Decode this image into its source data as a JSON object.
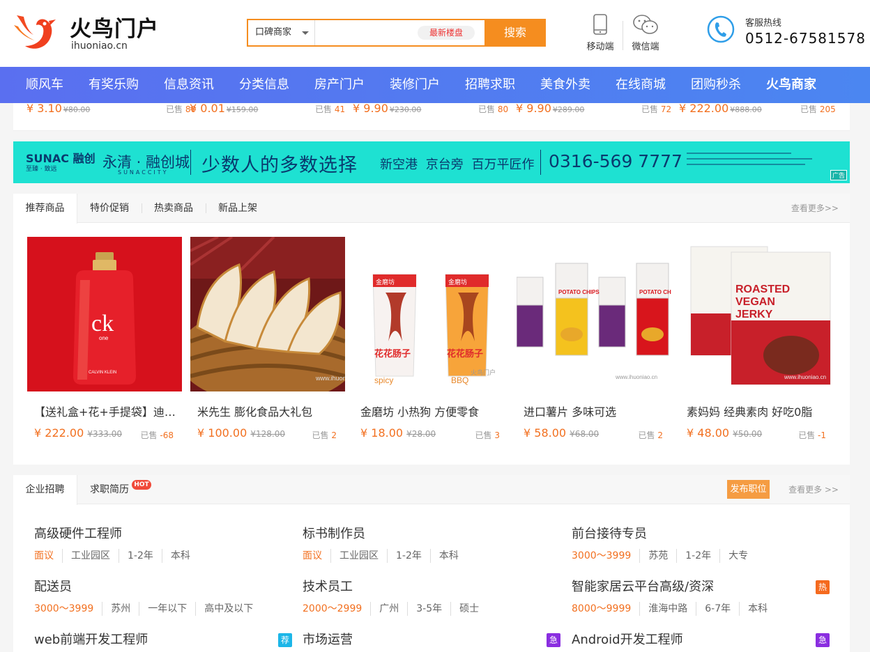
{
  "header": {
    "logo_text": "火鸟门户",
    "logo_domain": "ihuoniao.cn",
    "search_type": "口碑商家",
    "search_placeholder": "",
    "search_tag": "最新楼盘",
    "search_button": "搜索",
    "mobile_label": "移动端",
    "wechat_label": "微信端",
    "hotline_label": "客服热线",
    "hotline_number": "0512-67581578"
  },
  "nav": [
    "顺风车",
    "有奖乐购",
    "信息资讯",
    "分类信息",
    "房产门户",
    "装修门户",
    "招聘求职",
    "美食外卖",
    "在线商城",
    "团购秒杀",
    "火鸟商家"
  ],
  "strip": [
    {
      "price": "¥ 3.10",
      "old": "¥80.00",
      "sold_label": "已售",
      "sold": "80"
    },
    {
      "price": "¥ 0.01",
      "old": "¥159.00",
      "sold_label": "已售",
      "sold": "41"
    },
    {
      "price": "¥ 9.90",
      "old": "¥230.00",
      "sold_label": "已售",
      "sold": "80"
    },
    {
      "price": "¥ 9.90",
      "old": "¥289.00",
      "sold_label": "已售",
      "sold": "72"
    },
    {
      "price": "¥ 222.00",
      "old": "¥888.00",
      "sold_label": "已售",
      "sold": "205"
    }
  ],
  "banner": {
    "brand": "SUNAC 融创",
    "brand_sub": "至臻 · 致远",
    "title": "永清 · 融创城",
    "title_sub": "SUNACCITY",
    "slogan": "少数人的多数选择",
    "tags": "新空港 京台旁 百万平匠作",
    "phone": "0316-569 7777",
    "ad_label": "广告"
  },
  "goods": {
    "tabs": [
      "推荐商品",
      "特价促销",
      "热卖商品",
      "新品上架"
    ],
    "more": "查看更多>>",
    "items": [
      {
        "name": "【送礼盒+花+手提袋】迪奥香水",
        "price": "¥ 222.00",
        "old": "¥333.00",
        "sold_label": "已售",
        "sold": "-68",
        "image": "perfume-image"
      },
      {
        "name": "米先生 膨化食品大礼包",
        "price": "¥ 100.00",
        "old": "¥128.00",
        "sold_label": "已售",
        "sold": "2",
        "image": "bread-image"
      },
      {
        "name": "金磨坊 小热狗 方便零食",
        "price": "¥ 18.00",
        "old": "¥28.00",
        "sold_label": "已售",
        "sold": "3",
        "image": "sausage-image"
      },
      {
        "name": "进口薯片 多味可选",
        "price": "¥ 58.00",
        "old": "¥68.00",
        "sold_label": "已售",
        "sold": "2",
        "image": "chips-image"
      },
      {
        "name": "素妈妈 经典素肉 好吃0脂",
        "price": "¥ 48.00",
        "old": "¥50.00",
        "sold_label": "已售",
        "sold": "-1",
        "image": "jerky-image"
      }
    ],
    "image_text": {
      "perfume_brand": "ck",
      "perfume_sub": "one",
      "perfume_small": "CALVIN KLEIN",
      "sausage_brand": "金磨坊",
      "sausage_label": "花花肠子",
      "sausage_flavor1": "spicy",
      "sausage_flavor2": "BBQ",
      "chips_label": "POTATO CHIPS",
      "jerky_label1": "ROASTED",
      "jerky_label2": "VEGAN",
      "jerky_label3": "JERKY",
      "watermark": "火鸟门户",
      "watermark_domain": "www.ihuoniao.cn"
    }
  },
  "jobs": {
    "tabs": [
      "企业招聘",
      "求职简历"
    ],
    "hot_badge": "HOT",
    "publish": "发布职位",
    "more": "查看更多 >>",
    "items": [
      {
        "title": "高级硬件工程师",
        "salary": "面议",
        "area": "工业园区",
        "exp": "1-2年",
        "edu": "本科",
        "tag": "",
        "tag_color": ""
      },
      {
        "title": "标书制作员",
        "salary": "面议",
        "area": "工业园区",
        "exp": "1-2年",
        "edu": "本科",
        "tag": "",
        "tag_color": ""
      },
      {
        "title": "前台接待专员",
        "salary": "3000～3999",
        "area": "苏苑",
        "exp": "1-2年",
        "edu": "大专",
        "tag": "",
        "tag_color": ""
      },
      {
        "title": "配送员",
        "salary": "3000～3999",
        "area": "苏州",
        "exp": "一年以下",
        "edu": "高中及以下",
        "tag": "",
        "tag_color": ""
      },
      {
        "title": "技术员工",
        "salary": "2000～2999",
        "area": "广州",
        "exp": "3-5年",
        "edu": "硕士",
        "tag": "",
        "tag_color": ""
      },
      {
        "title": "智能家居云平台高级/资深",
        "salary": "8000～9999",
        "area": "淮海中路",
        "exp": "6-7年",
        "edu": "本科",
        "tag": "热",
        "tag_color": "#f56a1e"
      },
      {
        "title": "web前端开发工程师",
        "salary": "",
        "area": "",
        "exp": "",
        "edu": "",
        "tag": "荐",
        "tag_color": "#1cb6e8"
      },
      {
        "title": "市场运营",
        "salary": "",
        "area": "",
        "exp": "",
        "edu": "",
        "tag": "急",
        "tag_color": "#8a2ee0"
      },
      {
        "title": "Android开发工程师",
        "salary": "",
        "area": "",
        "exp": "",
        "edu": "",
        "tag": "急",
        "tag_color": "#8a2ee0"
      }
    ]
  },
  "colors": {
    "accent": "#f58d1f",
    "nav_start": "#5a6ff0",
    "nav_end": "#4b86f1",
    "price": "#f27020",
    "banner": "#1ee1d2"
  }
}
